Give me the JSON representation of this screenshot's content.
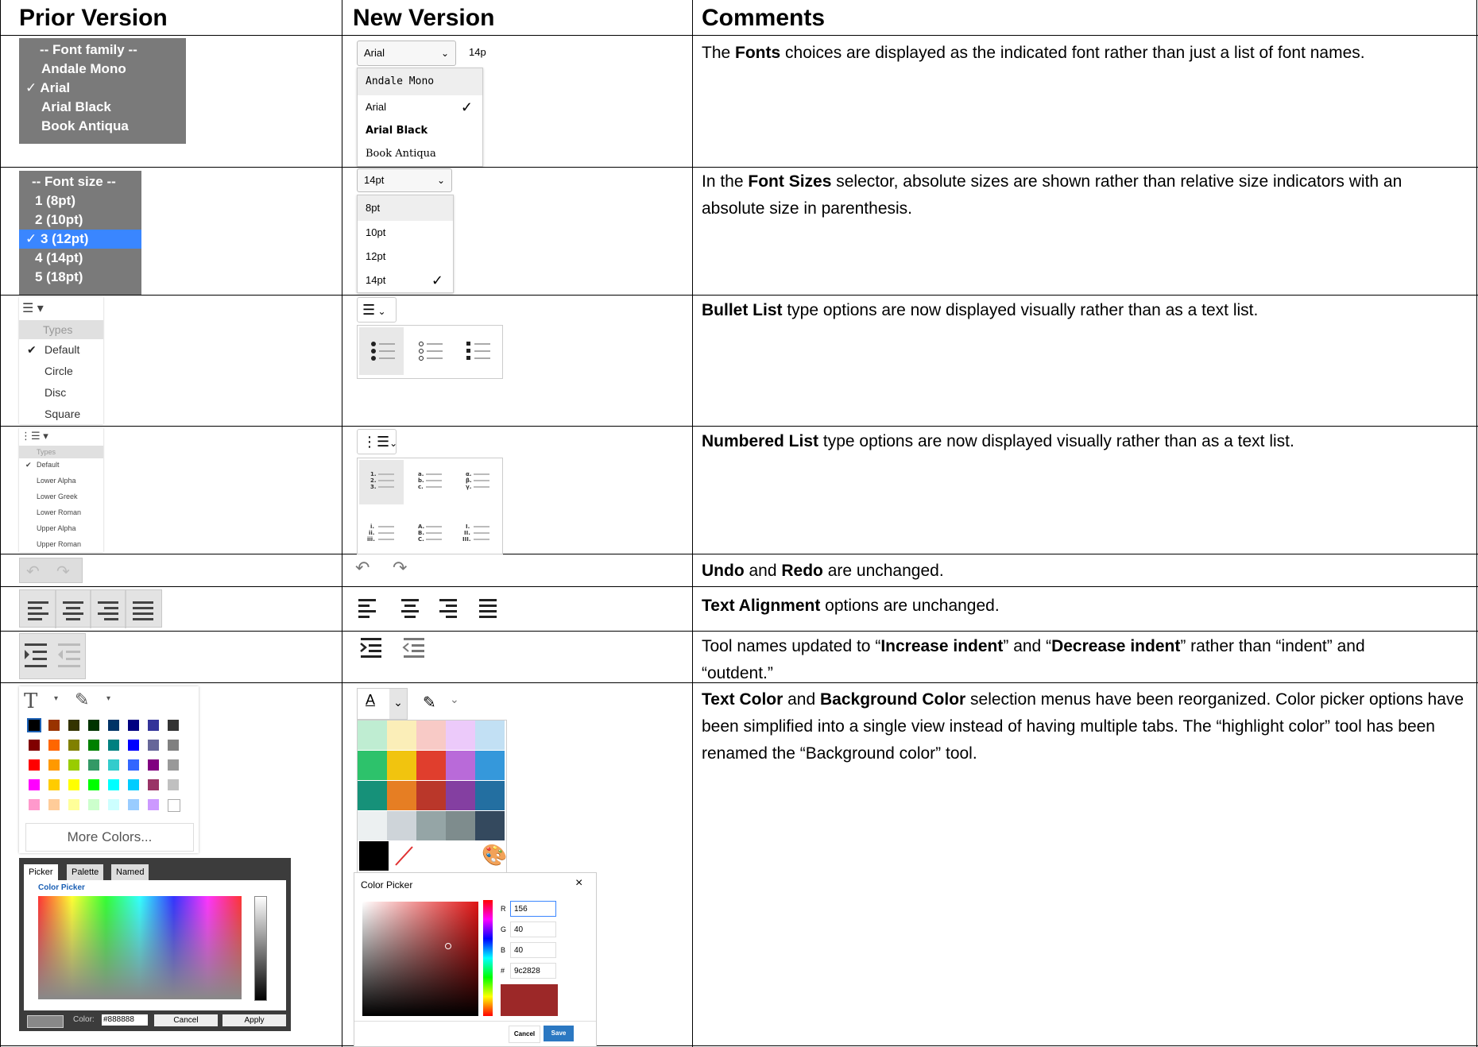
{
  "headers": {
    "prior": "Prior Version",
    "new": "New Version",
    "comments": "Comments"
  },
  "rows": {
    "fonts": {
      "prior_items": [
        "-- Font family --",
        "Andale Mono",
        "✓ Arial",
        "Arial Black",
        "Book Antiqua"
      ],
      "new_select": "Arial",
      "new_size_hint": "14p",
      "new_items": [
        "Andale Mono",
        "Arial",
        "Arial Black",
        "Book Antiqua"
      ],
      "comment_pre": "The ",
      "comment_bold": "Fonts",
      "comment_post": " choices are displayed as the indicated font rather than just a list of font names."
    },
    "sizes": {
      "prior_items": [
        "-- Font size --",
        "1 (8pt)",
        "2 (10pt)",
        "✓ 3 (12pt)",
        "4 (14pt)",
        "5 (18pt)"
      ],
      "new_select": "14pt",
      "new_items": [
        "8pt",
        "10pt",
        "12pt",
        "14pt"
      ],
      "comment_pre": "In the ",
      "comment_bold": "Font Sizes",
      "comment_post": " selector, absolute sizes are shown rather than relative size indicators with an absolute size in parenthesis."
    },
    "bullets": {
      "prior_items": [
        "Types",
        "Default",
        "Circle",
        "Disc",
        "Square"
      ],
      "comment_bold": "Bullet List",
      "comment_post": " type options are now displayed visually rather than as a text list."
    },
    "numbered": {
      "prior_items": [
        "Types",
        "Default",
        "Lower Alpha",
        "Lower Greek",
        "Lower Roman",
        "Upper Alpha",
        "Upper Roman"
      ],
      "comment_bold": "Numbered List",
      "comment_post": " type options are now displayed visually rather than as a text list."
    },
    "undo": {
      "b1": "Undo",
      "mid": " and ",
      "b2": "Redo",
      "post": " are unchanged."
    },
    "align": {
      "b1": "Text Alignment",
      "post": " options are unchanged."
    },
    "indent": {
      "pre": "Tool names updated to “",
      "b1": "Increase indent",
      "mid": "” and “",
      "b2": "Decrease indent",
      "post": "” rather than “indent” and “outdent.”"
    },
    "color": {
      "b1": "Text Color",
      "mid": " and ",
      "b2": "Background Color",
      "post": " selection menus have been reorganized. Color picker options have been simplified into a single view instead of having multiple tabs. The “highlight color” tool has been renamed the “Background color” tool.",
      "prior_more": "More Colors...",
      "prior_tabs": [
        "Picker",
        "Palette",
        "Named"
      ],
      "prior_picker_title": "Color Picker",
      "prior_color_label": "Color:",
      "prior_color_value": "#888888",
      "prior_cancel": "Cancel",
      "prior_apply": "Apply",
      "new_picker_title": "Color Picker",
      "new_close": "×",
      "new_r_label": "R",
      "new_r": "156",
      "new_g_label": "G",
      "new_g": "40",
      "new_b_label": "B",
      "new_b": "40",
      "new_hex_label": "#",
      "new_hex": "9c2828",
      "new_cancel": "Cancel",
      "new_save": "Save",
      "new_font_letter": "A",
      "prior_font_letter": "T"
    }
  },
  "colors": {
    "selected_blue": "#3a86ff",
    "save_blue": "#2b78c2",
    "picked": "#9c2828"
  }
}
